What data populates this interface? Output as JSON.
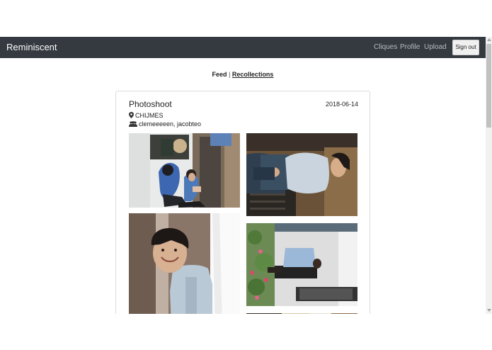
{
  "navbar": {
    "brand": "Reminiscent",
    "links": [
      "Cliques",
      "Profile",
      "Upload"
    ],
    "signout_label": "Sign out"
  },
  "tabs": {
    "feed": "Feed",
    "separator": "|",
    "recollections": "Recollections"
  },
  "post": {
    "title": "Photoshoot",
    "date": "2018-06-14",
    "location": "CHIJMES",
    "members": "clemeeeeen, jacobteo",
    "icons": {
      "location": "map-marker-icon",
      "members": "users-icon"
    }
  },
  "colors": {
    "navbar_bg": "#343a40",
    "brand_text": "#ffffff",
    "nav_link_text": "#b8bcc0"
  }
}
